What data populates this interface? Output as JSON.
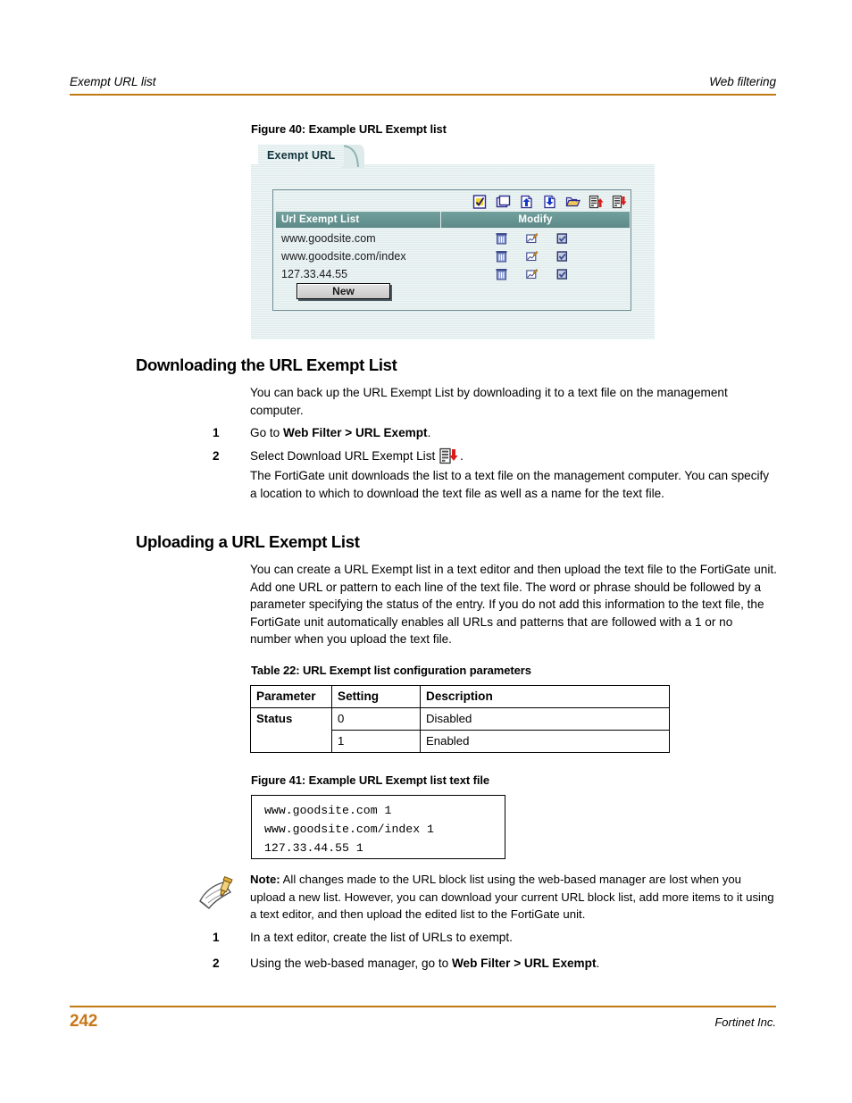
{
  "header": {
    "left": "Exempt URL list",
    "right": "Web filtering",
    "rule_color": "#c07a14"
  },
  "footer": {
    "page_number": "242",
    "right": "Fortinet Inc.",
    "page_number_color": "#c8781a"
  },
  "figure40": {
    "caption": "Figure 40: Example URL Exempt list",
    "tab_label": "Exempt URL",
    "columns": {
      "name": "Url Exempt List",
      "modify": "Modify"
    },
    "header_color": "#62908e",
    "canvas_color": "#dfebeb",
    "toolbar_icons": [
      "edit-document-icon",
      "copy-icon",
      "upload-page-icon",
      "download-page-icon",
      "open-folder-icon",
      "upload-list-icon",
      "download-list-icon"
    ],
    "rows": [
      {
        "url": "www.goodsite.com",
        "actions": [
          "delete-icon",
          "edit-icon",
          "enabled-checkbox"
        ]
      },
      {
        "url": "www.goodsite.com/index",
        "actions": [
          "delete-icon",
          "edit-icon",
          "enabled-checkbox"
        ]
      },
      {
        "url": "127.33.44.55",
        "actions": [
          "delete-icon",
          "edit-icon",
          "enabled-checkbox"
        ]
      }
    ],
    "new_button": "New"
  },
  "section_download": {
    "heading": "Downloading the URL Exempt List",
    "intro": "You can back up the URL Exempt List by downloading it to a text file on the management computer.",
    "steps": [
      {
        "num": "1",
        "pre": "Go to ",
        "bold": "Web Filter > URL Exempt",
        "post": "."
      },
      {
        "num": "2",
        "pre": "Select Download URL Exempt List ",
        "icon": "download-list-icon",
        "post": ".",
        "detail": "The FortiGate unit downloads the list to a text file on the management computer. You can specify a location to which to download the text file as well as a name for the text file."
      }
    ]
  },
  "section_upload": {
    "heading": "Uploading a URL Exempt List",
    "intro": "You can create a URL Exempt list in a text editor and then upload the text file to the FortiGate unit. Add one URL or pattern to each line of the text file. The word or phrase should be followed by a parameter specifying the status of the entry. If you do not add this information to the text file, the FortiGate unit automatically enables all URLs and patterns that are followed with a 1 or no number when you upload the text file."
  },
  "table22": {
    "caption": "Table 22: URL Exempt list configuration parameters",
    "columns": [
      "Parameter",
      "Setting",
      "Description"
    ],
    "rows": [
      {
        "parameter": "Status",
        "setting": "0",
        "description": "Disabled"
      },
      {
        "parameter": "",
        "setting": "1",
        "description": "Enabled"
      }
    ]
  },
  "figure41": {
    "caption": "Figure 41: Example URL Exempt list text file",
    "lines": [
      "www.goodsite.com 1",
      "www.goodsite.com/index 1",
      "127.33.44.55 1"
    ]
  },
  "note": {
    "icon": "note-pencil-icon",
    "label": "Note:",
    "text": " All changes made to the URL block list using the web-based manager are lost when you upload a new list. However, you can download your current URL block list, add more items to it using a text editor, and then upload the edited list to the FortiGate unit."
  },
  "final_steps": [
    {
      "num": "1",
      "pre": "In a text editor, create the list of URLs to exempt.",
      "bold": "",
      "post": ""
    },
    {
      "num": "2",
      "pre": "Using the web-based manager, go to ",
      "bold": "Web Filter > URL Exempt",
      "post": "."
    }
  ]
}
